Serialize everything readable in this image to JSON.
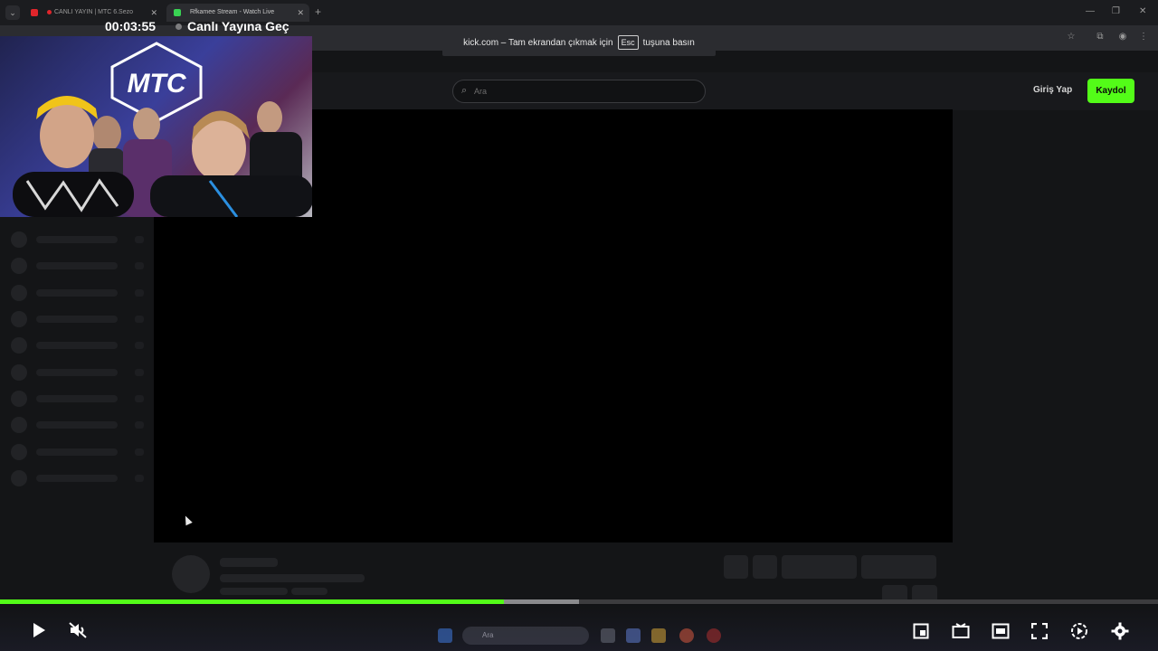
{
  "browser": {
    "tabs": [
      {
        "title": "CANLI YAYIN | MTC 6.Sezo",
        "active": false
      },
      {
        "title": "Rfkamee Stream - Watch Live",
        "active": true
      }
    ],
    "fullscreen_notice": {
      "before": "kick.com – Tam ekrandan çıkmak için",
      "key": "Esc",
      "after": "tuşuna basın"
    }
  },
  "site": {
    "search_placeholder": "Ara",
    "login_label": "Giriş Yap",
    "signup_label": "Kaydol",
    "accent_color": "#53fc18"
  },
  "webcam": {
    "logo_text": "MTC"
  },
  "player": {
    "time_display": "00:03:55",
    "live_label": "Canlı Yayına Geç",
    "progress_played": 0.435,
    "progress_buffered": 0.5,
    "controls": [
      "play-icon",
      "mute-icon",
      "pip-icon",
      "theater-icon",
      "miniplayer-icon",
      "fullscreen-icon",
      "speed-icon",
      "settings-icon"
    ]
  },
  "taskbar": {
    "search_placeholder": "Ara"
  }
}
